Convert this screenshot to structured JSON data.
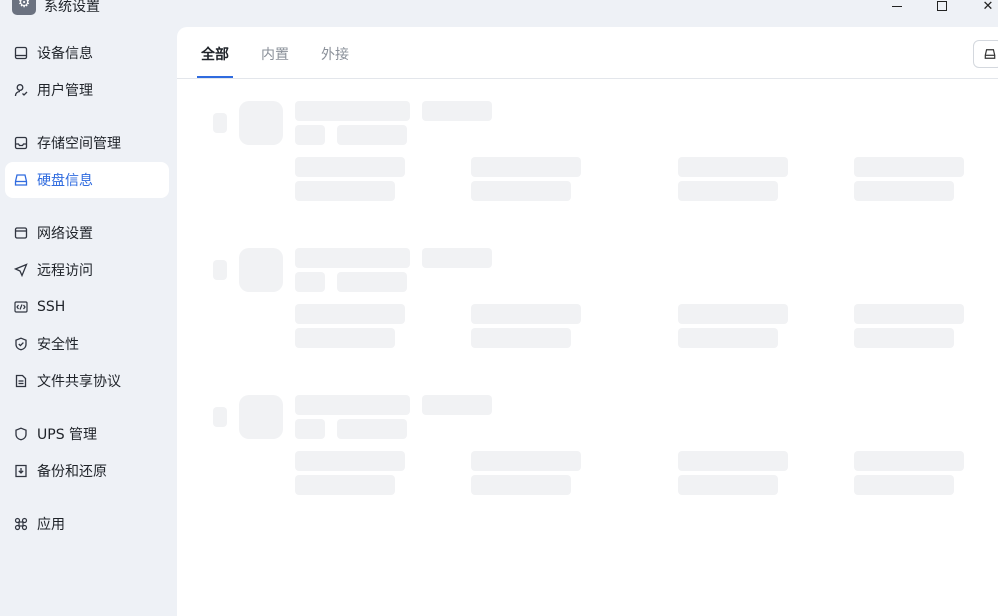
{
  "window": {
    "title": "系统设置",
    "controls": {
      "minimize": "minimize",
      "maximize": "maximize",
      "close": "✕"
    }
  },
  "sidebar": {
    "items": [
      {
        "label": "设备信息",
        "icon": "device-icon",
        "active": false
      },
      {
        "label": "用户管理",
        "icon": "user-icon",
        "active": false
      },
      {
        "label": "存储空间管理",
        "icon": "storage-icon",
        "active": false
      },
      {
        "label": "硬盘信息",
        "icon": "disk-icon",
        "active": true
      },
      {
        "label": "网络设置",
        "icon": "network-icon",
        "active": false
      },
      {
        "label": "远程访问",
        "icon": "send-icon",
        "active": false
      },
      {
        "label": "SSH",
        "icon": "code-icon",
        "active": false
      },
      {
        "label": "安全性",
        "icon": "shield-check-icon",
        "active": false
      },
      {
        "label": "文件共享协议",
        "icon": "document-icon",
        "active": false
      },
      {
        "label": "UPS 管理",
        "icon": "shield-icon",
        "active": false
      },
      {
        "label": "备份和还原",
        "icon": "backup-icon",
        "active": false
      },
      {
        "label": "应用",
        "icon": "command-icon",
        "active": false
      }
    ]
  },
  "main": {
    "tabs": [
      {
        "label": "全部",
        "active": true
      },
      {
        "label": "内置",
        "active": false
      },
      {
        "label": "外接",
        "active": false
      }
    ]
  },
  "colors": {
    "accent": "#2f6bdf",
    "sidebar_bg": "#eef1f6",
    "panel_bg": "#ffffff",
    "skeleton": "#f1f2f4"
  }
}
